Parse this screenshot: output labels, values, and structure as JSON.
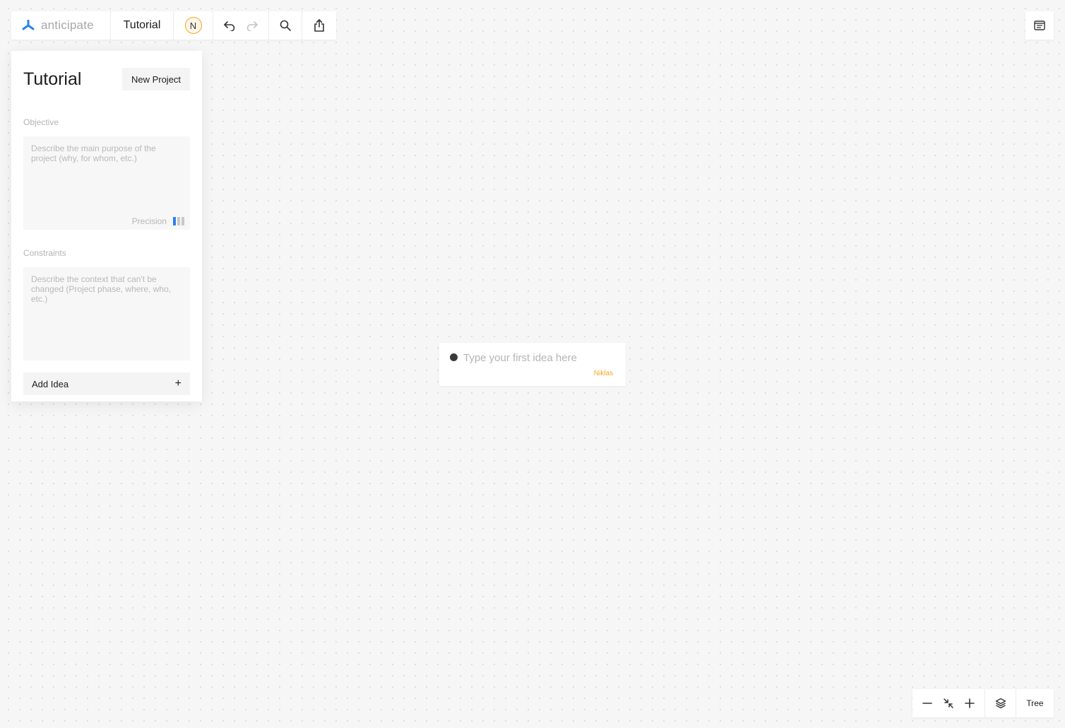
{
  "brand": {
    "name": "anticipate",
    "logo_icon": "anticipate-logo-icon",
    "logo_color": "#2b82f0"
  },
  "toolbar": {
    "project_title": "Tutorial",
    "avatar_initial": "N",
    "avatar_color": "#f5a623",
    "undo_icon": "undo-icon",
    "redo_icon": "redo-icon",
    "search_icon": "search-icon",
    "share_icon": "share-icon"
  },
  "panel": {
    "title": "Tutorial",
    "new_project_label": "New Project",
    "objective": {
      "label": "Objective",
      "placeholder": "Describe the main purpose of the project (why, for whom, etc.)",
      "precision_label": "Precision",
      "precision_level": "1/3"
    },
    "constraints": {
      "label": "Constraints",
      "placeholder": "Describe the context that can't be changed (Project phase, where, who, etc.)"
    },
    "add_idea_label": "Add Idea",
    "add_idea_icon": "+"
  },
  "idea_card": {
    "placeholder": "Type your first idea here",
    "author": "Niklas"
  },
  "controls": {
    "zoom_out_icon": "minus-icon",
    "fit_icon": "collapse-icon",
    "zoom_in_icon": "plus-icon",
    "layers_icon": "layers-icon",
    "view_mode_label": "Tree"
  },
  "top_right": {
    "notes_icon": "notes-icon"
  }
}
